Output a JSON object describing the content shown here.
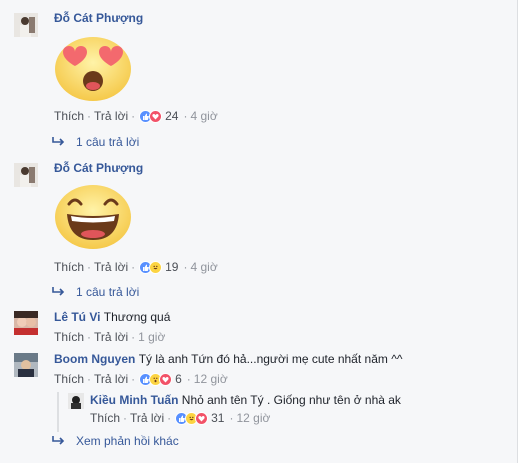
{
  "comments": [
    {
      "author": "Đỗ Cát Phượng",
      "sticker": "heart-eyes-emoji",
      "actions": {
        "like": "Thích",
        "reply": "Trả lời",
        "reactions": "24",
        "time": "4 giờ"
      },
      "replies_link": "1 câu trả lời"
    },
    {
      "author": "Đỗ Cát Phượng",
      "sticker": "laughing-emoji",
      "actions": {
        "like": "Thích",
        "reply": "Trả lời",
        "reactions": "19",
        "time": "4 giờ"
      },
      "replies_link": "1 câu trả lời"
    },
    {
      "author": "Lê Tú Vi",
      "text": "Thương quá",
      "actions": {
        "like": "Thích",
        "reply": "Trả lời",
        "time": "1 giờ"
      }
    },
    {
      "author": "Boom Nguyen",
      "text": "Tý là anh Tứn đó hả...người mẹ cute nhất năm ^^",
      "actions": {
        "like": "Thích",
        "reply": "Trả lời",
        "reactions": "6",
        "time": "12 giờ"
      }
    }
  ],
  "reply": {
    "author": "Kiều Minh Tuấn",
    "text": "Nhỏ anh tên Tý . Giống như tên ở nhà ak",
    "actions": {
      "like": "Thích",
      "reply": "Trả lời",
      "reactions": "31",
      "time": "12 giờ"
    }
  },
  "more_replies": "Xem phản hồi khác",
  "separator": "·",
  "colors": {
    "link": "#365899",
    "meta": "#90949c",
    "like": "#5890ff",
    "love": "#f25268",
    "haha": "#fcd442"
  }
}
